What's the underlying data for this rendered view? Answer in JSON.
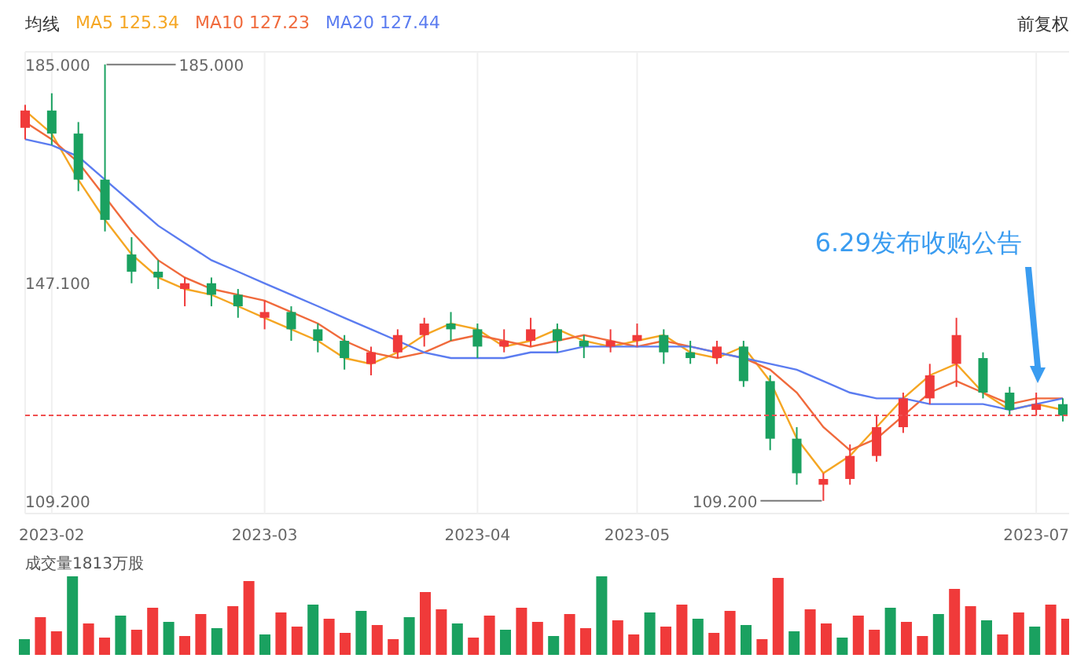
{
  "legend": {
    "title": "均线",
    "values": [
      "125.34",
      "127.23",
      "127.44"
    ]
  },
  "adjust_label": "前复权",
  "chart": {
    "chart_data": {
      "type": "candlestick",
      "categories": [
        null,
        "2023-02",
        null,
        null,
        null,
        null,
        null,
        null,
        null,
        "2023-03",
        null,
        null,
        null,
        null,
        null,
        null,
        null,
        "2023-04",
        null,
        null,
        null,
        null,
        null,
        "2023-05",
        null,
        null,
        null,
        null,
        null,
        null,
        null,
        null,
        null,
        null,
        null,
        null,
        null,
        null,
        "2023-07",
        null
      ],
      "ylim": [
        107,
        187.2
      ],
      "yticks": [
        {
          "value": 185,
          "label": "185.000"
        },
        {
          "value": 147.1,
          "label": "147.100"
        },
        {
          "value": 109.2,
          "label": "109.200"
        }
      ],
      "grid": true,
      "ohlc": [
        [
          174,
          178,
          172,
          177
        ],
        [
          177,
          180,
          171,
          173
        ],
        [
          173,
          175,
          163,
          165
        ],
        [
          165,
          185,
          156,
          158
        ],
        [
          152,
          155,
          147,
          149
        ],
        [
          149,
          151,
          146,
          148
        ],
        [
          146,
          148,
          143,
          147
        ],
        [
          147,
          148,
          143,
          145
        ],
        [
          145,
          146,
          141,
          143
        ],
        [
          141,
          144,
          139,
          142
        ],
        [
          142,
          143,
          137,
          139
        ],
        [
          139,
          140,
          135,
          137
        ],
        [
          137,
          138,
          132,
          134
        ],
        [
          133,
          136,
          131,
          135
        ],
        [
          135,
          139,
          134,
          138
        ],
        [
          138,
          141,
          136,
          140
        ],
        [
          140,
          142,
          137,
          139
        ],
        [
          139,
          140,
          134,
          136
        ],
        [
          136,
          139,
          135,
          137
        ],
        [
          137,
          141,
          136,
          139
        ],
        [
          139,
          140,
          135,
          137
        ],
        [
          137,
          138,
          134,
          136
        ],
        [
          136,
          139,
          135,
          137
        ],
        [
          137,
          140,
          136,
          138
        ],
        [
          138,
          139,
          133,
          135
        ],
        [
          135,
          137,
          133,
          134
        ],
        [
          134,
          137,
          133,
          136
        ],
        [
          136,
          137,
          129,
          130
        ],
        [
          130,
          131,
          118,
          120
        ],
        [
          120,
          122,
          112,
          114
        ],
        [
          112,
          114,
          109.2,
          113
        ],
        [
          113,
          119,
          112,
          117
        ],
        [
          117,
          124,
          116,
          122
        ],
        [
          122,
          128,
          121,
          127
        ],
        [
          127,
          133,
          126,
          131
        ],
        [
          133,
          141,
          129,
          138
        ],
        [
          134,
          135,
          127,
          128
        ],
        [
          128,
          129,
          124,
          125
        ],
        [
          125,
          128,
          124,
          126
        ],
        [
          126,
          127,
          123,
          124
        ]
      ],
      "series": [
        {
          "name": "MA5",
          "type": "line",
          "color": "#f5a623",
          "values": [
            177,
            173,
            165,
            158,
            152,
            148,
            146,
            145,
            143,
            141,
            139,
            137,
            134,
            133,
            135,
            138,
            140,
            139,
            136,
            137,
            139,
            137,
            136,
            137,
            138,
            135,
            134,
            136,
            130,
            120,
            114,
            117,
            122,
            127,
            131,
            133,
            128,
            125,
            126,
            125
          ]
        },
        {
          "name": "MA10",
          "type": "line",
          "color": "#f06a3c",
          "values": [
            175,
            172,
            168,
            162,
            156,
            151,
            148,
            146,
            145,
            144,
            142,
            140,
            137,
            135,
            134,
            135,
            137,
            138,
            137,
            136,
            137,
            138,
            137,
            136,
            137,
            136,
            135,
            134,
            132,
            128,
            122,
            118,
            120,
            124,
            128,
            130,
            128,
            126,
            127,
            127
          ]
        },
        {
          "name": "MA20",
          "type": "line",
          "color": "#5b7cf0",
          "values": [
            172,
            171,
            169,
            165,
            161,
            157,
            154,
            151,
            149,
            147,
            145,
            143,
            141,
            139,
            137,
            135,
            134,
            134,
            134,
            135,
            135,
            136,
            136,
            136,
            136,
            136,
            135,
            134,
            133,
            132,
            130,
            128,
            127,
            127,
            126,
            126,
            126,
            125,
            126,
            127
          ]
        }
      ],
      "annotations": [
        "185.000",
        "109.200",
        "6.29发布收购公告"
      ]
    }
  },
  "volume": {
    "label": "成交量1813万股"
  }
}
